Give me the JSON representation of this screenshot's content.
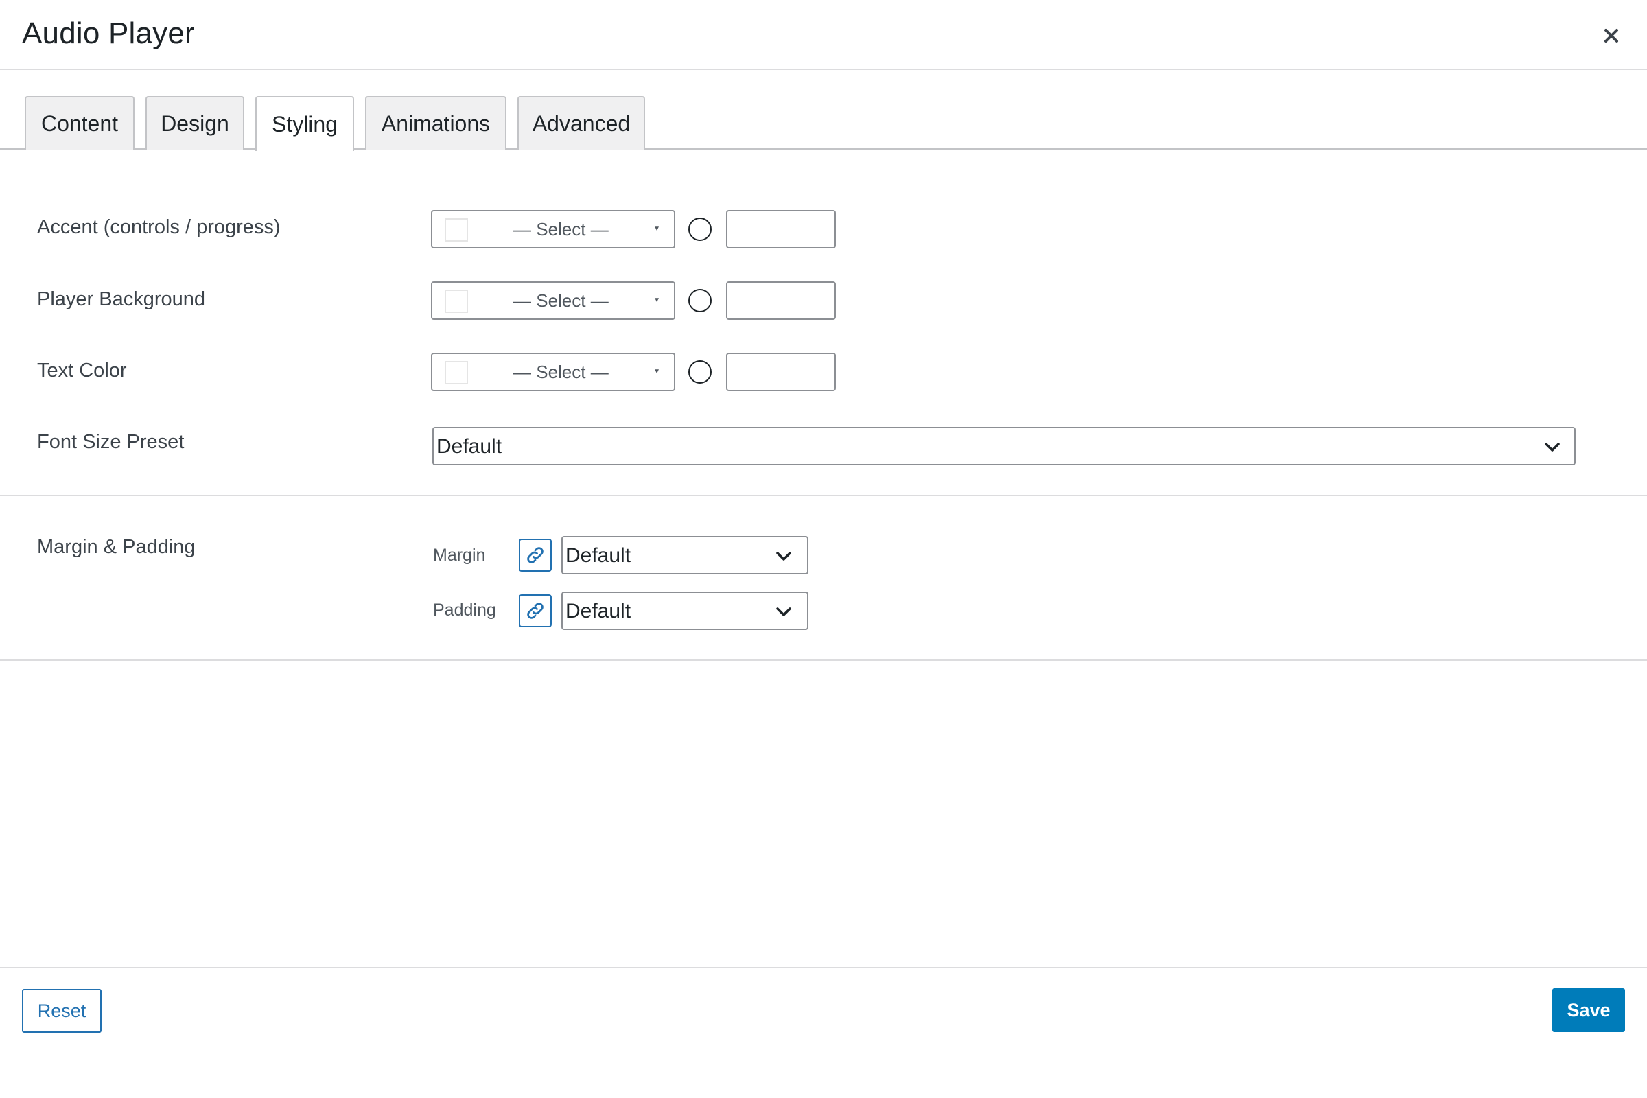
{
  "dialog": {
    "title": "Audio Player",
    "close_icon": "close-icon"
  },
  "tabs": [
    {
      "label": "Content",
      "active": false
    },
    {
      "label": "Design",
      "active": false
    },
    {
      "label": "Styling",
      "active": true
    },
    {
      "label": "Animations",
      "active": false
    },
    {
      "label": "Advanced",
      "active": false
    }
  ],
  "styling": {
    "accent": {
      "label": "Accent (controls / progress)",
      "select": "— Select —",
      "value": ""
    },
    "background": {
      "label": "Player Background",
      "select": "— Select —",
      "value": ""
    },
    "text_color": {
      "label": "Text Color",
      "select": "— Select —",
      "value": ""
    },
    "font_size": {
      "label": "Font Size Preset",
      "value": "Default"
    }
  },
  "spacing": {
    "label": "Margin & Padding",
    "margin": {
      "label": "Margin",
      "value": "Default"
    },
    "padding": {
      "label": "Padding",
      "value": "Default"
    }
  },
  "footer": {
    "reset_label": "Reset",
    "save_label": "Save"
  },
  "colors": {
    "primary": "#007cba",
    "link": "#2271b1",
    "border": "#8c8f94",
    "divider": "#dcdcde"
  }
}
